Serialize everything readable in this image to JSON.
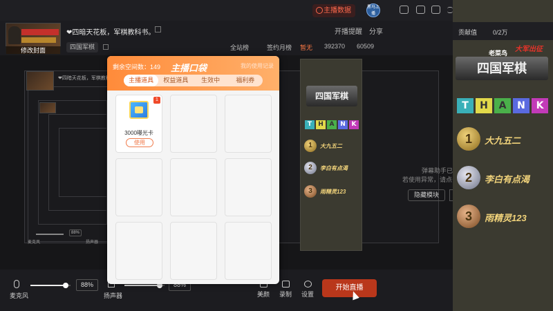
{
  "topbar": {
    "stats_label": "主播数据",
    "qr_text": "黑马上播"
  },
  "header": {
    "cover_label": "修改封面",
    "room_title": "❤四暗天花板，军棋教科书。",
    "category": "四国军棋",
    "links": {
      "notify": "开播提醒",
      "share": "分享"
    },
    "ranks": {
      "all_site": "全站榜",
      "sign_month": "签约月榜",
      "none": "暂无",
      "count1": "392370",
      "count2": "60509"
    }
  },
  "preview": {
    "mini_title": "❤四暗天花板，军棋教科书。",
    "hint1": "弹幕助手已全",
    "hint2": "若使用异常，请点击",
    "hide_button": "隐藏模块",
    "mini_controls": {
      "pct": "88%",
      "mic": "麦克风",
      "speaker": "扬声器"
    }
  },
  "bottom": {
    "mic_label": "麦克风",
    "speaker_label": "扬声器",
    "mic_pct": "88%",
    "speaker_pct": "88%",
    "mic_level": 0.88,
    "speaker_level": 0.88,
    "tools": [
      "美颜",
      "录制",
      "设置"
    ],
    "start_button": "开始直播"
  },
  "modal": {
    "space_text": "剩余空间数：149",
    "title": "主播口袋",
    "usage_link": "我的使用记录",
    "tabs": [
      "主播道具",
      "权益道具",
      "生效中",
      "福利券"
    ],
    "active_tab": 0,
    "items": [
      {
        "badge": "1",
        "name": "3000曝光卡",
        "button": "使用"
      }
    ]
  },
  "sidebar": {
    "contrib_label": "贡献值",
    "contrib_value": "0/2万",
    "small_logo": "老菜鸟",
    "big_logo": "四国军棋",
    "logo_slogan": "大军出征",
    "thank": [
      "T",
      "H",
      "A",
      "N",
      "K"
    ],
    "thank_colors": [
      "#3ab0b8",
      "#e2d94a",
      "#4ab04a",
      "#5a6ae0",
      "#c23ab8"
    ],
    "ranks": [
      {
        "medal": "1",
        "name": "大九五二"
      },
      {
        "medal": "2",
        "name": "李白有点渴"
      },
      {
        "medal": "3",
        "name": "雨精灵123"
      }
    ]
  },
  "colors": {
    "accent": "#ff6a4d",
    "start_button": "#b9371b",
    "modal_header": "#ff8b3a"
  }
}
